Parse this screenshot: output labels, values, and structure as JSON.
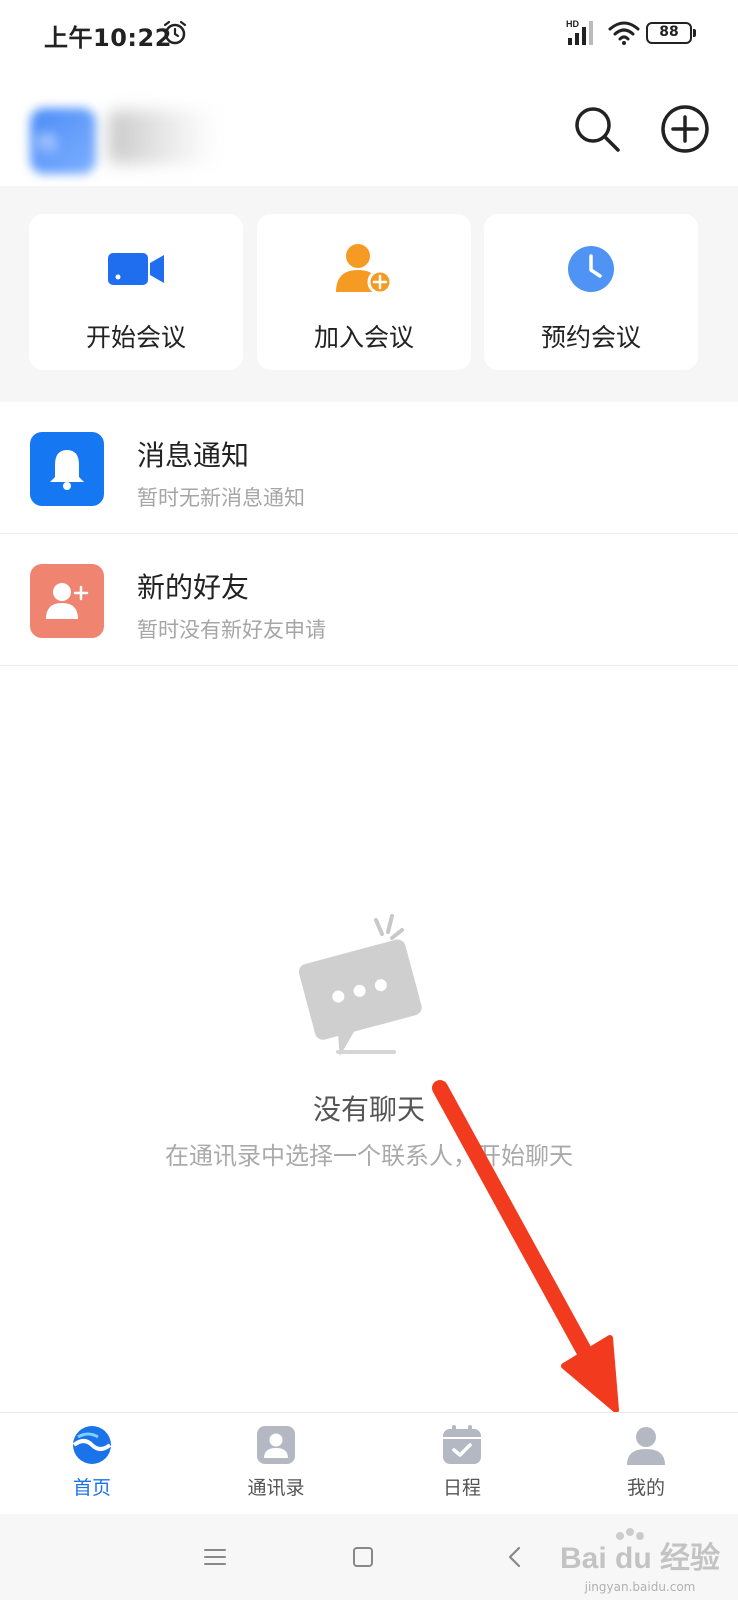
{
  "status_bar": {
    "time": "上午10:22",
    "battery": "88",
    "network_label": "HD"
  },
  "header": {
    "avatar_text": "杨"
  },
  "quick_actions": [
    {
      "label": "开始会议",
      "icon": "video-camera-icon"
    },
    {
      "label": "加入会议",
      "icon": "person-add-icon"
    },
    {
      "label": "预约会议",
      "icon": "clock-icon"
    }
  ],
  "list": [
    {
      "title": "消息通知",
      "subtitle": "暂时无新消息通知",
      "icon": "bell-icon",
      "color": "#1677f2"
    },
    {
      "title": "新的好友",
      "subtitle": "暂时没有新好友申请",
      "icon": "add-friend-icon",
      "color": "#ef8471"
    }
  ],
  "empty_state": {
    "title": "没有聊天",
    "subtitle": "在通讯录中选择一个联系人，开始聊天"
  },
  "bottom_nav": [
    {
      "label": "首页",
      "icon": "home-logo-icon",
      "active": true
    },
    {
      "label": "通讯录",
      "icon": "contacts-icon",
      "active": false
    },
    {
      "label": "日程",
      "icon": "calendar-icon",
      "active": false
    },
    {
      "label": "我的",
      "icon": "profile-icon",
      "active": false
    }
  ],
  "colors": {
    "accent": "#1a73e8",
    "arrow": "#f23a1f",
    "video": "#1f6ef0",
    "join": "#f59a23",
    "schedule": "#4f94f5"
  },
  "watermark": {
    "brand": "Bai du 经验",
    "url": "jingyan.baidu.com"
  }
}
